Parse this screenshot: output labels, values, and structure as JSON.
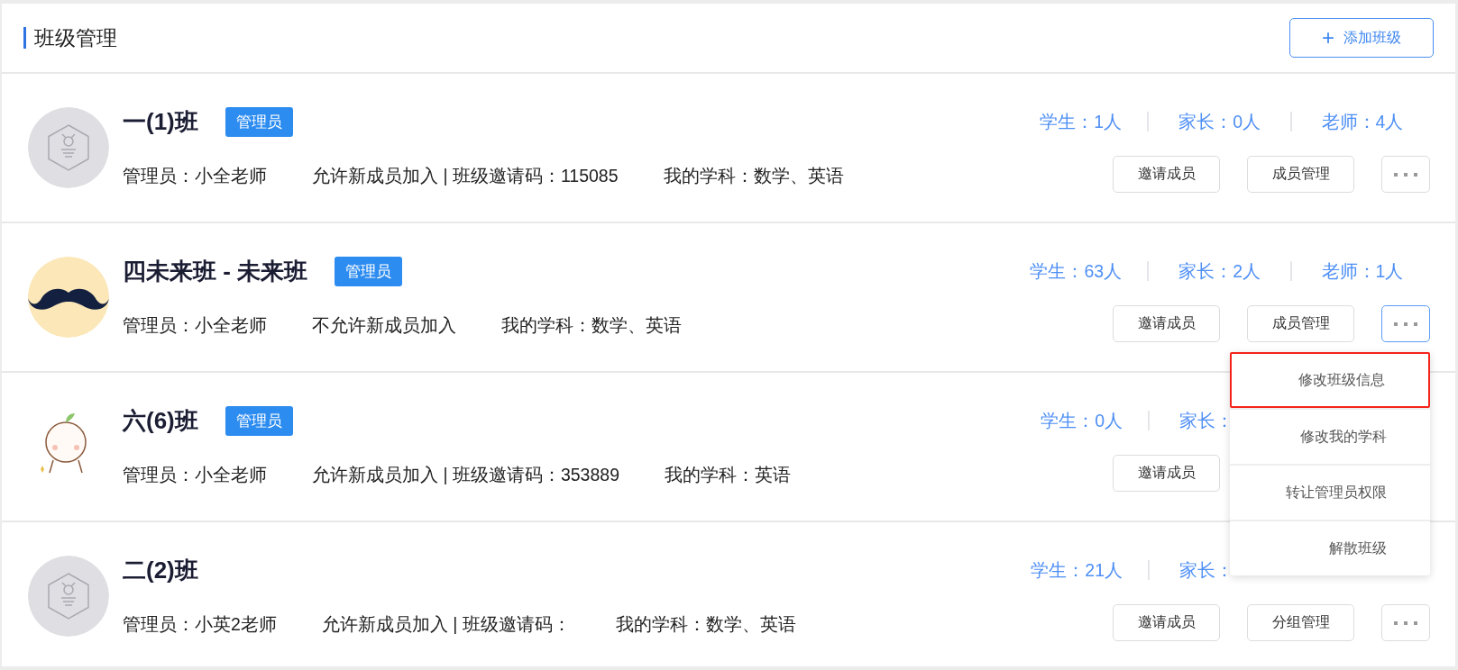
{
  "header": {
    "title": "班级管理",
    "add_button": {
      "icon": "+",
      "label": "添加班级"
    }
  },
  "classes": [
    {
      "name": "一(1)班",
      "badge": "管理员",
      "avatar": {
        "kind": "default"
      },
      "info": [
        "管理员：小全老师",
        "允许新成员加入 | 班级邀请码：115085",
        "我的学科：数学、英语"
      ],
      "stats": [
        "学生：1人",
        "家长：0人",
        "老师：4人"
      ],
      "actions": [
        {
          "kind": "button",
          "label": "邀请成员"
        },
        {
          "kind": "button",
          "label": "成员管理"
        },
        {
          "kind": "more",
          "active": false
        }
      ]
    },
    {
      "name": "四未来班 - 未来班",
      "badge": "管理员",
      "avatar": {
        "kind": "picture"
      },
      "info": [
        "管理员：小全老师",
        "不允许新成员加入",
        "我的学科：数学、英语"
      ],
      "stats": [
        "学生：63人",
        "家长：2人",
        "老师：1人"
      ],
      "actions": [
        {
          "kind": "button",
          "label": "邀请成员"
        },
        {
          "kind": "button",
          "label": "成员管理"
        },
        {
          "kind": "more",
          "active": true
        }
      ]
    },
    {
      "name": "六(6)班",
      "badge": "管理员",
      "avatar": {
        "kind": "picture"
      },
      "info": [
        "管理员：小全老师",
        "允许新成员加入 | 班级邀请码：353889",
        "我的学科：英语"
      ],
      "stats": [
        "学生：0人",
        "家长："
      ],
      "actions": [
        {
          "kind": "button",
          "label": "邀请成员"
        }
      ]
    },
    {
      "name": "二(2)班",
      "avatar": {
        "kind": "default"
      },
      "info": [
        "管理员：小英2老师",
        "允许新成员加入 | 班级邀请码：",
        "我的学科：数学、英语"
      ],
      "stats": [
        "学生：21人",
        "家长："
      ],
      "actions": [
        {
          "kind": "button",
          "label": "邀请成员"
        },
        {
          "kind": "button",
          "label": "分组管理"
        },
        {
          "kind": "more",
          "active": false
        }
      ]
    }
  ],
  "dropdown_menu": [
    {
      "label": "修改班级信息",
      "highlighted": true
    },
    {
      "label": "修改我的学科",
      "highlighted": false
    },
    {
      "label": "转让管理员权限",
      "highlighted": false
    },
    {
      "label": "解散班级",
      "highlighted": false
    }
  ]
}
